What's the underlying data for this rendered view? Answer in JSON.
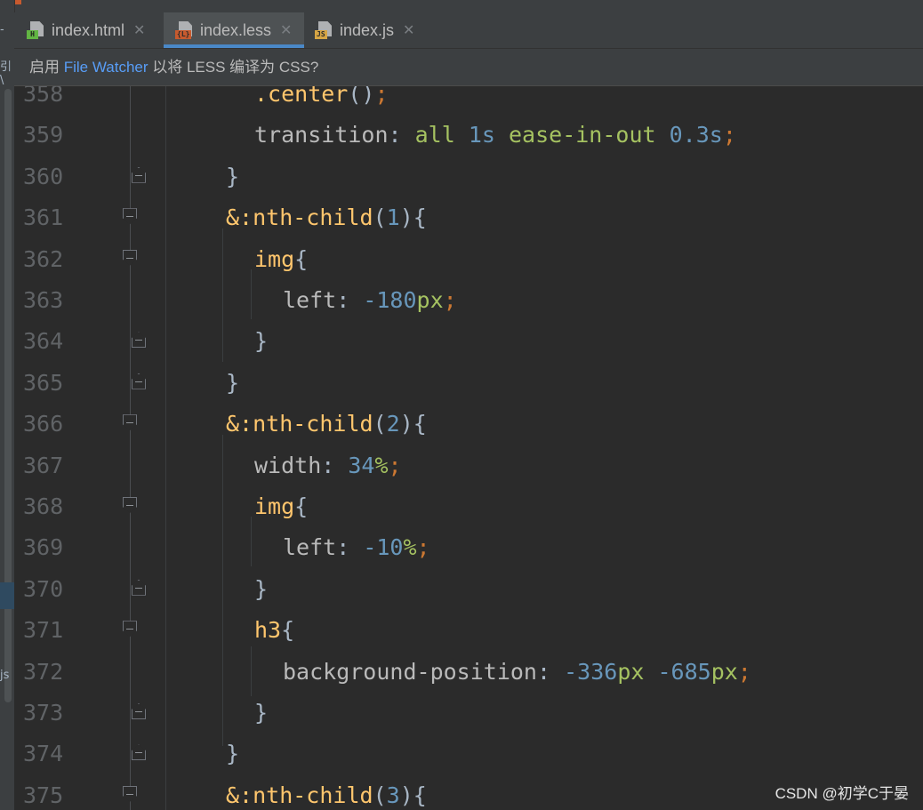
{
  "tabs": [
    {
      "label": "index.html",
      "icon": "html-file-icon",
      "badge": "H",
      "active": false
    },
    {
      "label": "index.less",
      "icon": "less-file-icon",
      "badge": "{L}",
      "active": true
    },
    {
      "label": "index.js",
      "icon": "js-file-icon",
      "badge": "JS",
      "active": false
    }
  ],
  "notification": {
    "prefix": "启用 ",
    "link": "File Watcher",
    "suffix": " 以将 LESS 编译为 CSS?"
  },
  "left_strip": {
    "glyph_top": "-",
    "glyph_mid": "引\\",
    "glyph_bottom": "js"
  },
  "editor": {
    "lines": [
      {
        "num": "358",
        "indent": 1,
        "tokens": [
          [
            "t-sel",
            ".center"
          ],
          [
            "t-br",
            "()"
          ],
          [
            "t-punc",
            ";"
          ]
        ]
      },
      {
        "num": "359",
        "indent": 1,
        "tokens": [
          [
            "t-prop",
            "transition"
          ],
          [
            "t-br",
            ": "
          ],
          [
            "t-val",
            "all "
          ],
          [
            "t-num",
            "1s "
          ],
          [
            "t-val",
            "ease-in-out "
          ],
          [
            "t-num",
            "0.3s"
          ],
          [
            "t-punc",
            ";"
          ]
        ]
      },
      {
        "num": "360",
        "indent": 0,
        "tokens": [
          [
            "t-br",
            "}"
          ]
        ]
      },
      {
        "num": "361",
        "indent": 0,
        "tokens": [
          [
            "t-sel",
            "&:nth-child"
          ],
          [
            "t-br",
            "("
          ],
          [
            "t-num",
            "1"
          ],
          [
            "t-br",
            "){"
          ]
        ]
      },
      {
        "num": "362",
        "indent": 1,
        "tokens": [
          [
            "t-sel",
            "img"
          ],
          [
            "t-br",
            "{"
          ]
        ]
      },
      {
        "num": "363",
        "indent": 2,
        "tokens": [
          [
            "t-prop",
            "left"
          ],
          [
            "t-br",
            ": "
          ],
          [
            "t-num",
            "-180"
          ],
          [
            "t-val",
            "px"
          ],
          [
            "t-punc",
            ";"
          ]
        ]
      },
      {
        "num": "364",
        "indent": 1,
        "tokens": [
          [
            "t-br",
            "}"
          ]
        ]
      },
      {
        "num": "365",
        "indent": 0,
        "tokens": [
          [
            "t-br",
            "}"
          ]
        ]
      },
      {
        "num": "366",
        "indent": 0,
        "tokens": [
          [
            "t-sel",
            "&:nth-child"
          ],
          [
            "t-br",
            "("
          ],
          [
            "t-num",
            "2"
          ],
          [
            "t-br",
            "){"
          ]
        ]
      },
      {
        "num": "367",
        "indent": 1,
        "tokens": [
          [
            "t-prop",
            "width"
          ],
          [
            "t-br",
            ": "
          ],
          [
            "t-num",
            "34"
          ],
          [
            "t-val",
            "%"
          ],
          [
            "t-punc",
            ";"
          ]
        ]
      },
      {
        "num": "368",
        "indent": 1,
        "tokens": [
          [
            "t-sel",
            "img"
          ],
          [
            "t-br",
            "{"
          ]
        ]
      },
      {
        "num": "369",
        "indent": 2,
        "tokens": [
          [
            "t-prop",
            "left"
          ],
          [
            "t-br",
            ": "
          ],
          [
            "t-num",
            "-10"
          ],
          [
            "t-val",
            "%"
          ],
          [
            "t-punc",
            ";"
          ]
        ]
      },
      {
        "num": "370",
        "indent": 1,
        "tokens": [
          [
            "t-br",
            "}"
          ]
        ]
      },
      {
        "num": "371",
        "indent": 1,
        "tokens": [
          [
            "t-sel",
            "h3"
          ],
          [
            "t-br",
            "{"
          ]
        ]
      },
      {
        "num": "372",
        "indent": 2,
        "tokens": [
          [
            "t-prop",
            "background-position"
          ],
          [
            "t-br",
            ": "
          ],
          [
            "t-num",
            "-336"
          ],
          [
            "t-val",
            "px "
          ],
          [
            "t-num",
            "-685"
          ],
          [
            "t-val",
            "px"
          ],
          [
            "t-punc",
            ";"
          ]
        ]
      },
      {
        "num": "373",
        "indent": 1,
        "tokens": [
          [
            "t-br",
            "}"
          ]
        ]
      },
      {
        "num": "374",
        "indent": 0,
        "tokens": [
          [
            "t-br",
            "}"
          ]
        ]
      },
      {
        "num": "375",
        "indent": 0,
        "tokens": [
          [
            "t-sel",
            "&:nth-child"
          ],
          [
            "t-br",
            "("
          ],
          [
            "t-num",
            "3"
          ],
          [
            "t-br",
            "){"
          ]
        ]
      }
    ],
    "folds": {
      "360": "close",
      "361": "open",
      "362": "open",
      "364": "close",
      "365": "close",
      "366": "open",
      "368": "open",
      "370": "close",
      "371": "open",
      "373": "close",
      "374": "close",
      "375": "open"
    }
  },
  "watermark": "CSDN @初学C于晏",
  "colors": {
    "background": "#2b2b2b",
    "selector": "#ffc66d",
    "property": "#bababa",
    "punctuation": "#cc7832",
    "number": "#6897bb",
    "value": "#a5c261",
    "link": "#589df6",
    "tab_active_underline": "#4a88c7"
  }
}
